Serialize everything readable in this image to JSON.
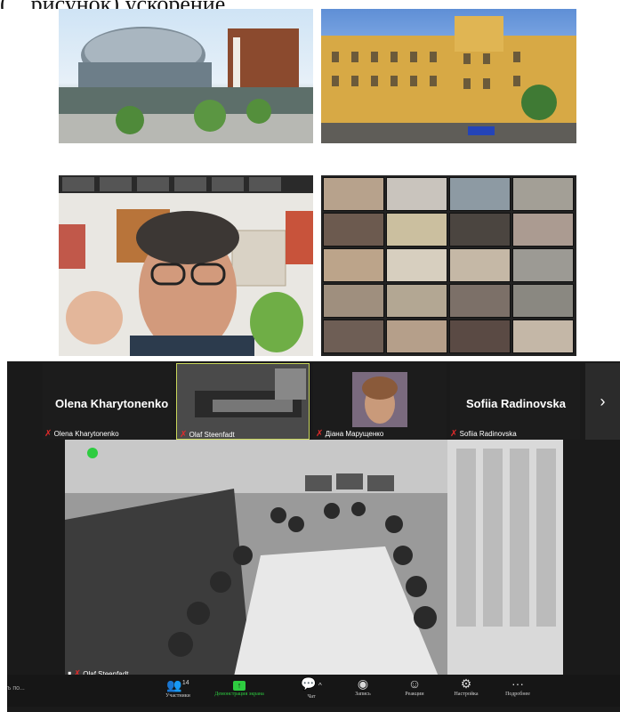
{
  "caption_fragment": "(…рисунок) ускорение…",
  "zoom": {
    "participants": {
      "left_name": "Olena Kharytonenko",
      "left_label": "Olena Kharytonenko",
      "center1_label": "Olaf Steenfadt",
      "center2_label": "Діана Марущенко",
      "right_name": "Sofiia Radinovska",
      "right_label": "Sofiia Radinovska",
      "main_label": "Olaf Steenfadt"
    },
    "toolbar": {
      "participants_count": "14",
      "participants": "Участники",
      "share": "Демонстрация экрана",
      "chat": "Чат",
      "record": "Запись",
      "reactions": "Реакции",
      "settings": "Настройка",
      "more": "Подробнее",
      "left_fragment": "ъ по..."
    },
    "colors": {
      "share_green": "#2ecc40",
      "active_speaker_border": "#c9d65a",
      "muted_red": "#e02a2a"
    }
  }
}
